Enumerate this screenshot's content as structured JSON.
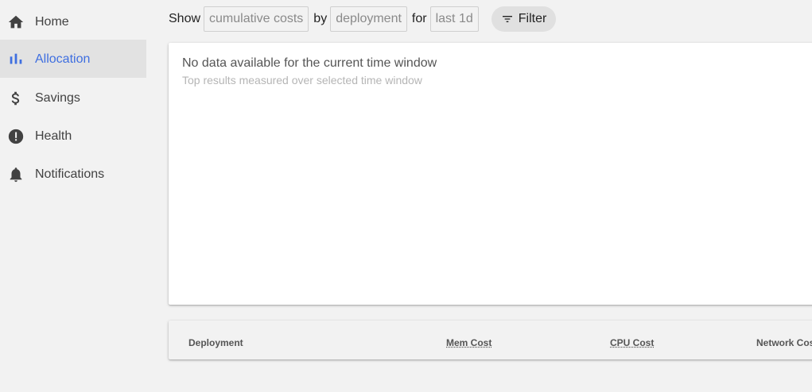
{
  "sidebar": {
    "items": [
      {
        "label": "Home",
        "icon": "home-icon"
      },
      {
        "label": "Allocation",
        "icon": "bar-chart-icon",
        "active": true
      },
      {
        "label": "Savings",
        "icon": "dollar-icon"
      },
      {
        "label": "Health",
        "icon": "alert-icon"
      },
      {
        "label": "Notifications",
        "icon": "bell-icon"
      }
    ],
    "active_color": "#3f6fe0"
  },
  "toolbar": {
    "show_label": "Show",
    "metric_value": "cumulative costs",
    "by_label": "by",
    "aggregate_value": "deployment",
    "for_label": "for",
    "window_value": "last 1d",
    "filter_label": "Filter"
  },
  "card": {
    "title": "No data available for the current time window",
    "subtitle": "Top results measured over selected time window"
  },
  "table": {
    "columns": [
      "Deployment",
      "Mem Cost",
      "CPU Cost",
      "Network Cost"
    ]
  }
}
